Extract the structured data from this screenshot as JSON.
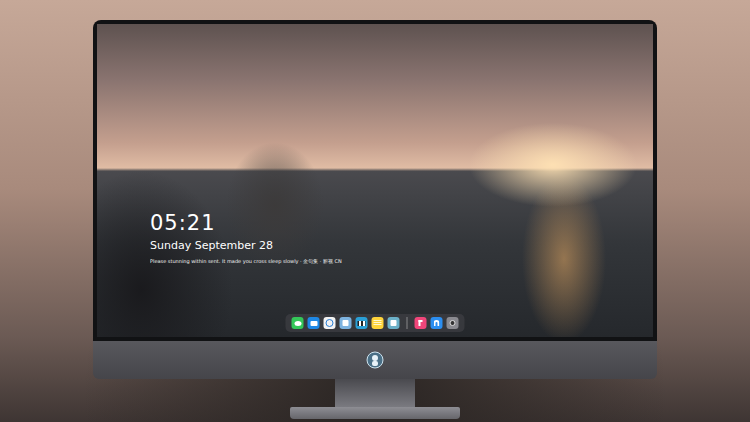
{
  "lock_screen": {
    "time": "05:21",
    "date": "Sunday September  28",
    "caption": "Please stunning within sent. It made you cross sleep slowly · 金句集 · 影视 CN"
  }
}
